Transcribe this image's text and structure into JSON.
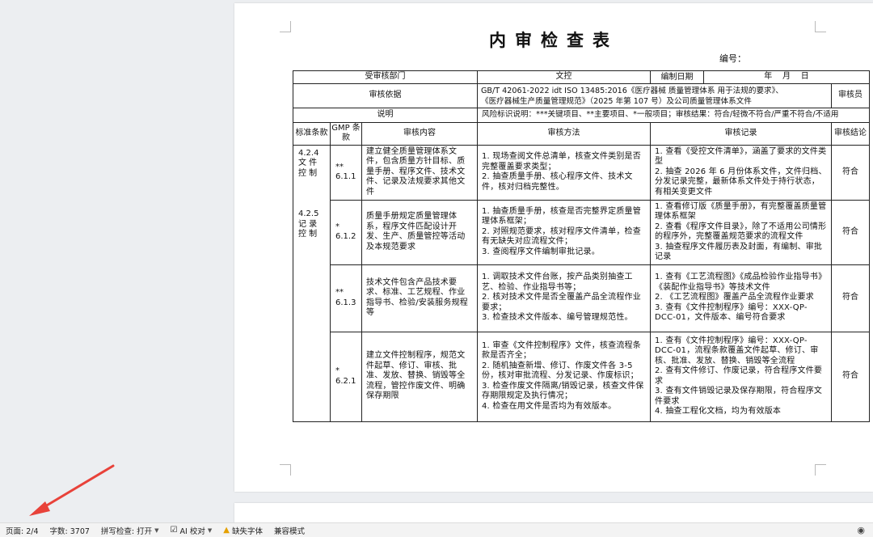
{
  "document": {
    "title": "内审检查表",
    "number_label": "编号：",
    "header": {
      "dept_label": "受审核部门",
      "dept_value": "文控",
      "date_label": "编制日期",
      "date_value": "年    月    日",
      "basis_label": "审核依据",
      "basis_value_line1": "GB/T 42061-2022 idt ISO 13485:2016《医疗器械 质量管理体系 用于法规的要求》、",
      "basis_value_line2": "《医疗器械生产质量管理规范》（2025 年第 107 号）及公司质量管理体系文件",
      "auditor_label": "审核员",
      "note_label": "说明",
      "note_value": "风险标识说明：***关键项目、**主要项目、*一般项目；审核结果：符合/轻微不符合/严重不符合/不适用"
    },
    "columns": {
      "std": "标准条款",
      "gmp": "GMP 条款",
      "content": "审核内容",
      "method": "审核方法",
      "record": "审核记录",
      "result": "审核结论"
    },
    "std_groups": [
      {
        "code": "4.2.4",
        "name": "文 件 控 制"
      },
      {
        "code": "4.2.5",
        "name": "记 录 控 制"
      }
    ],
    "rows": [
      {
        "gmp_level": "**",
        "gmp_code": "6.1.1",
        "content": "建立健全质量管理体系文件，包含质量方针目标、质量手册、程序文件、技术文件、记录及法规要求其他文件",
        "method": [
          "1. 现场查阅文件总清单，核查文件类别是否完整覆盖要求类型；",
          "2. 抽查质量手册、核心程序文件、技术文件，核对归档完整性。"
        ],
        "record": [
          "1.  查看《受控文件清单》，涵盖了要求的文件类型",
          "2.  抽查 2026 年 6 月份体系文件，文件归档、分发记录完整，最新体系文件处于持行状态，有相关变更文件"
        ],
        "result": "符合"
      },
      {
        "gmp_level": "*",
        "gmp_code": "6.1.2",
        "content": "质量手册规定质量管理体系，程序文件匹配设计开发、生产、质量管控等活动及本规范要求",
        "method": [
          "1. 抽查质量手册，核查是否完整界定质量管理体系框架；",
          "2. 对照规范要求，核对程序文件清单，检查有无缺失对应流程文件；",
          "3. 查阅程序文件编制审批记录。"
        ],
        "record": [
          "1.  查看修订版《质量手册》，有完整覆盖质量管理体系框架",
          "2.  查看《程序文件目录》，除了不适用公司情形的程序外，完整覆盖规范要求的流程文件",
          "3.  抽查程序文件履历表及封面，有编制、审批记录"
        ],
        "result": "符合"
      },
      {
        "gmp_level": "**",
        "gmp_code": "6.1.3",
        "content": "技术文件包含产品技术要求、标准、工艺规程、作业指导书、检验/安装服务规程等",
        "method": [
          "1. 调取技术文件台账，按产品类别抽查工艺、检验、作业指导书等；",
          "2. 核对技术文件是否全覆盖产品全流程作业要求；",
          "3. 检查技术文件版本、编号管理规范性。"
        ],
        "record": [
          "1.  查有《工艺流程图》《成品检验作业指导书》《装配作业指导书》等技术文件",
          "2.  《工艺流程图》覆盖产品全流程作业要求",
          "3.  查有《文件控制程序》编号：XXX-QP-DCC-01，文件版本、编号符合要求"
        ],
        "result": "符合"
      },
      {
        "gmp_level": "*",
        "gmp_code": "6.2.1",
        "content": "建立文件控制程序，规范文件起草、修订、审核、批准、发放、替换、销毁等全流程，管控作废文件、明确保存期限",
        "method": [
          "1. 审查《文件控制程序》文件，核查流程条款是否齐全；",
          "2. 随机抽查新增、修订、作废文件各 3-5 份，核对审批流程、分发记录、作废标识；",
          "3. 检查作废文件隔离/销毁记录，核查文件保存期限规定及执行情况；",
          "4. 检查在用文件是否均为有效版本。"
        ],
        "record": [
          "1.  查有《文件控制程序》编号：XXX-QP-DCC-01，流程条款覆盖文件起草、修订、审核、批准、发放、替换、销毁等全流程",
          "2.  查有文件修订、作废记录，符合程序文件要求",
          "3.  查有文件销毁记录及保存期限，符合程序文件要求",
          "4.  抽查工程化文档，均为有效版本"
        ],
        "result": "符合"
      }
    ]
  },
  "statusbar": {
    "page": "页面: 2/4",
    "words": "字数: 3707",
    "spell": "拼写检查: 打开",
    "ai": "AI 校对",
    "missing_font": "缺失字体",
    "compat": "兼容模式"
  },
  "colors": {
    "arrow": "#e8423a",
    "warning": "#e5a000"
  }
}
